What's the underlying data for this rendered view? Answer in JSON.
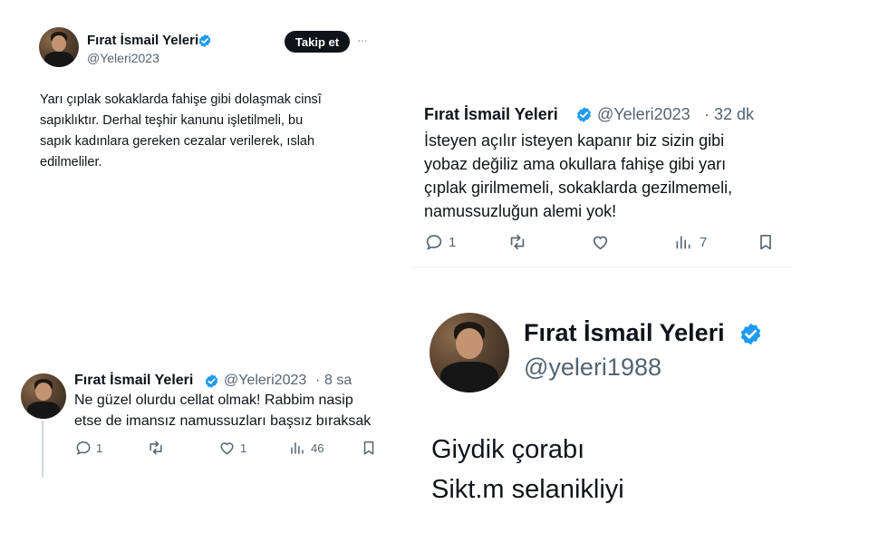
{
  "tweet1": {
    "name": "Fırat İsmail Yeleri",
    "handle": "@Yeleri2023",
    "follow_label": "Takip et",
    "more": "···",
    "lines": [
      "Yarı çıplak sokaklarda fahişe gibi dolaşmak cinsî",
      "sapıklıktır. Derhal teşhir kanunu işletilmeli, bu",
      "sapık kadınlara gereken cezalar verilerek, ıslah",
      "edilmeliler."
    ]
  },
  "tweet2": {
    "name": "Fırat İsmail Yeleri",
    "handle": "@Yeleri2023",
    "sep": "·",
    "time": "32 dk",
    "lines": [
      "İsteyen açılır isteyen kapanır biz sizin gibi",
      "yobaz değiliz ama okullara fahişe gibi yarı",
      "çıplak girilmemeli, sokaklarda gezilmemeli,",
      "namussuzluğun alemi yok!"
    ],
    "actions": {
      "replies": "1",
      "retweets": "",
      "likes": "",
      "views": "7"
    }
  },
  "tweet3": {
    "name": "Fırat İsmail Yeleri",
    "handle": "@Yeleri2023",
    "sep": "·",
    "time": "8 sa",
    "lines": [
      "Ne güzel olurdu cellat olmak! Rabbim nasip",
      "etse de imansız namussuzları başsız bıraksak"
    ],
    "actions": {
      "replies": "1",
      "retweets": "",
      "likes": "1",
      "views": "46"
    }
  },
  "tweet4": {
    "name": "Fırat İsmail Yeleri",
    "handle": "@yeleri1988",
    "lines": [
      "Giydik çorabı",
      "Sikt.m selanikliyi"
    ]
  },
  "icons": {
    "verified": "verified-badge-icon",
    "reply": "reply-icon",
    "retweet": "retweet-icon",
    "like": "heart-icon",
    "views": "views-icon",
    "bookmark": "bookmark-icon"
  },
  "colors": {
    "verified_blue": "#1d9bf0",
    "text": "#0f1419",
    "secondary": "#536471",
    "follow_bg": "#0f1419"
  }
}
